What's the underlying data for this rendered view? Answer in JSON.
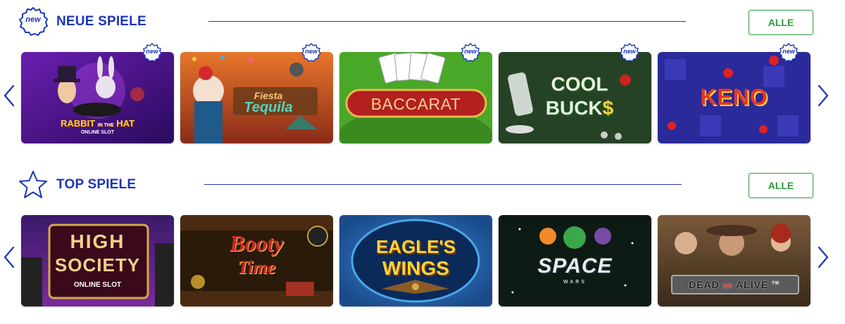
{
  "sections": {
    "new": {
      "title": "NEUE SPIELE",
      "button_label": "ALLE",
      "badge_text": "new",
      "icon": "new-badge-icon",
      "games": [
        {
          "name": "Rabbit in the Hat",
          "title_line1": "RABBIT",
          "title_small": "IN THE",
          "title_line2": "HAT",
          "subtitle": "ONLINE SLOT"
        },
        {
          "name": "Fiesta Tequila",
          "title_line1": "Fiesta",
          "title_line2": "Tequila"
        },
        {
          "name": "Baccarat",
          "title_line1": "BACCARAT"
        },
        {
          "name": "Cool Buck",
          "title_line1": "COOL",
          "title_line2": "BUCK",
          "symbol": "$"
        },
        {
          "name": "Keno",
          "title_line1": "KENO"
        }
      ]
    },
    "top": {
      "title": "TOP SPIELE",
      "button_label": "ALLE",
      "icon": "star-icon",
      "games": [
        {
          "name": "High Society",
          "title_line1": "HIGH",
          "title_line2": "SOCIETY",
          "subtitle": "ONLINE SLOT"
        },
        {
          "name": "Booty Time",
          "title_line1": "Booty",
          "title_line2": "Time"
        },
        {
          "name": "Eagle's Wings",
          "title_line1": "EAGLE'S",
          "title_line2": "WINGS"
        },
        {
          "name": "Space Wars",
          "title_line1": "SPACE",
          "subtitle": "WARS"
        },
        {
          "name": "Dead or Alive",
          "title_line1": "DEAD",
          "title_small": "OR",
          "title_line2": "ALIVE",
          "symbol": "TM"
        }
      ]
    }
  },
  "colors": {
    "brand_blue": "#1b36b4",
    "button_green": "#2e9a3e"
  }
}
